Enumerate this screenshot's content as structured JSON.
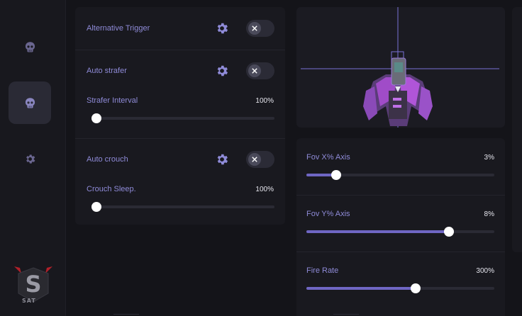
{
  "colors": {
    "accent": "#8f8bd8",
    "slider_fill": "#6f66c4",
    "logo_red": "#b0202a"
  },
  "sidebar": {
    "items": [
      {
        "icon": "skull-icon",
        "active": false
      },
      {
        "icon": "skull-icon",
        "active": true
      },
      {
        "icon": "gear-icon",
        "active": false
      }
    ],
    "logo_text": "SAT"
  },
  "left_panel": {
    "alternative_trigger": {
      "label": "Alternative Trigger",
      "enabled": false
    },
    "auto_strafer": {
      "label": "Auto strafer",
      "enabled": false
    },
    "strafer_interval": {
      "label": "Strafer Interval",
      "value_text": "100%",
      "fraction": 0.0
    },
    "auto_crouch": {
      "label": "Auto crouch",
      "enabled": false
    },
    "crouch_sleep": {
      "label": "Crouch Sleep.",
      "value_text": "100%",
      "fraction": 0.0
    }
  },
  "right_panel": {
    "fov_x": {
      "label": "Fov X% Axis",
      "value_text": "3%",
      "fraction": 0.16
    },
    "fov_y": {
      "label": "Fov Y% Axis",
      "value_text": "8%",
      "fraction": 0.76
    },
    "fire_rate": {
      "label": "Fire Rate",
      "value_text": "300%",
      "fraction": 0.58
    }
  }
}
